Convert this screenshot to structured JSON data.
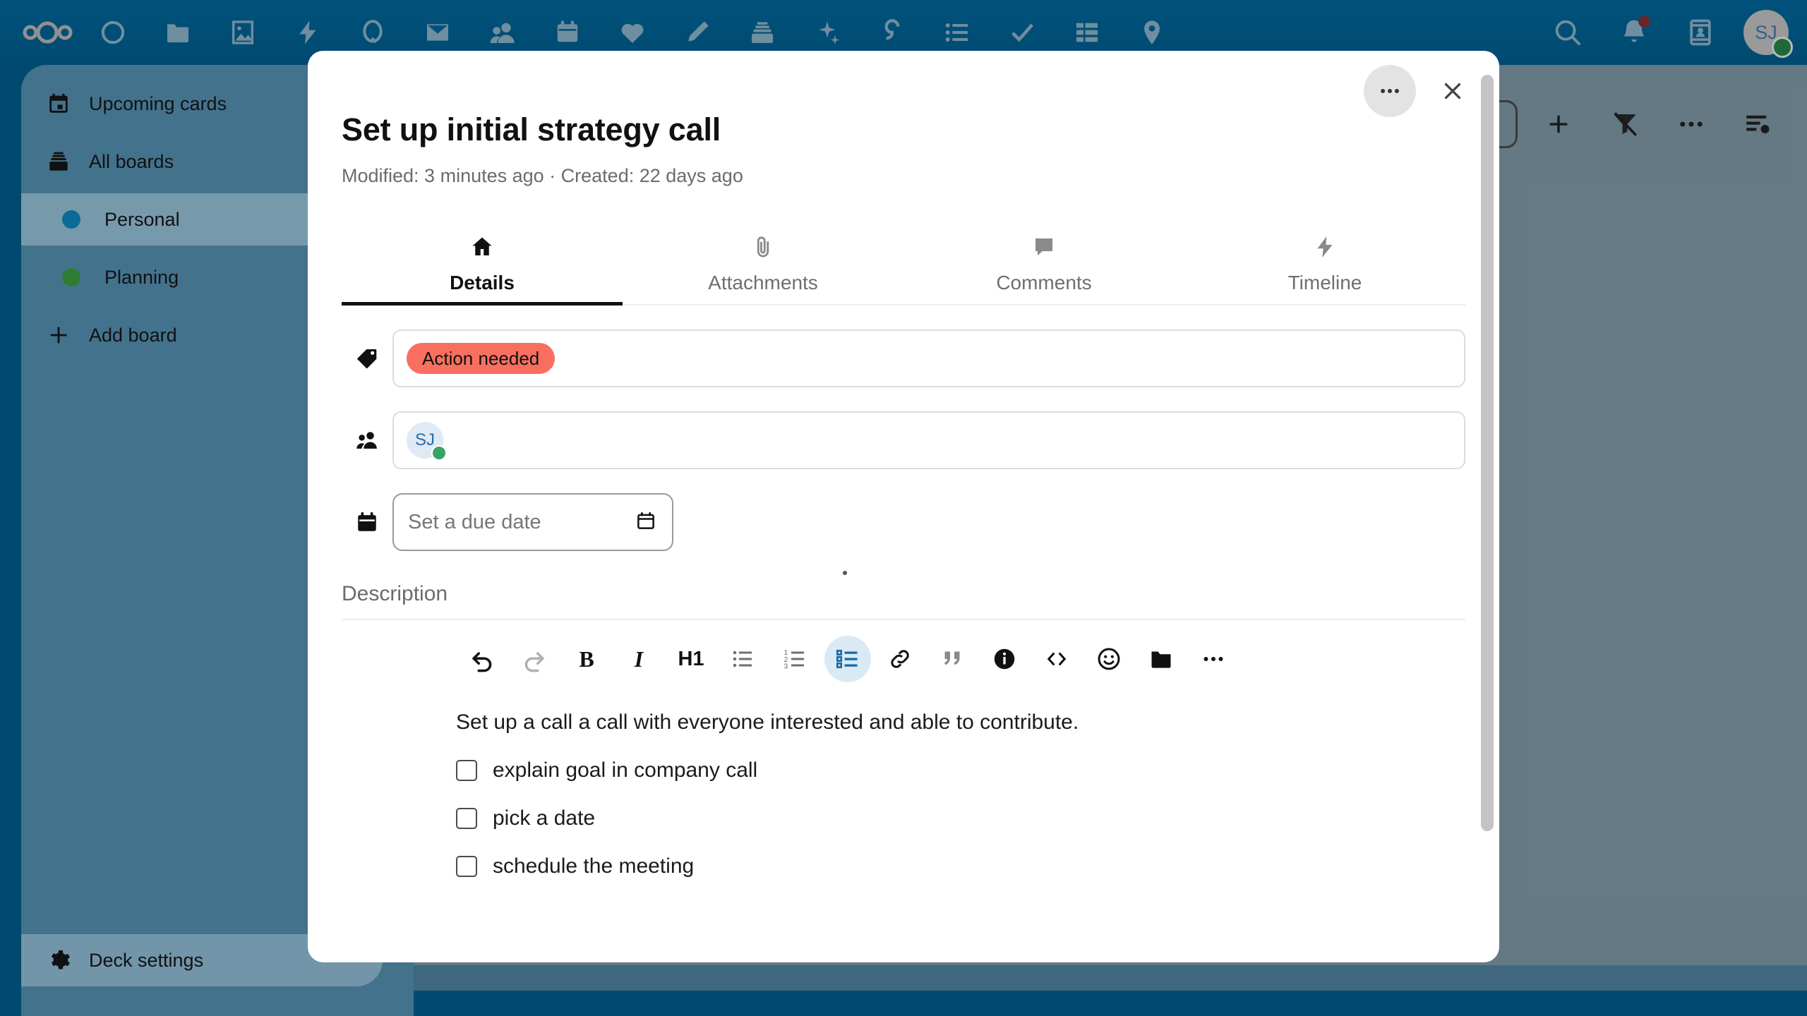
{
  "topnav": {
    "logo_name": "nextcloud-logo",
    "apps": [
      {
        "name": "dashboard-icon",
        "label": "Dashboard"
      },
      {
        "name": "files-icon",
        "label": "Files"
      },
      {
        "name": "photos-icon",
        "label": "Photos"
      },
      {
        "name": "activity-icon",
        "label": "Activity"
      },
      {
        "name": "circles-icon",
        "label": "Circles"
      },
      {
        "name": "mail-icon",
        "label": "Mail"
      },
      {
        "name": "contacts-icon",
        "label": "Contacts"
      },
      {
        "name": "calendar-icon",
        "label": "Calendar"
      },
      {
        "name": "health-icon",
        "label": "Health"
      },
      {
        "name": "notes-icon",
        "label": "Notes"
      },
      {
        "name": "deck-icon",
        "label": "Deck"
      },
      {
        "name": "assistant-icon",
        "label": "Assistant"
      },
      {
        "name": "collectives-icon",
        "label": "Collectives"
      },
      {
        "name": "tasks-list-icon",
        "label": "Tasks"
      },
      {
        "name": "checkmark-icon",
        "label": "Approvals"
      },
      {
        "name": "tables-icon",
        "label": "Tables"
      },
      {
        "name": "maps-icon",
        "label": "Maps"
      }
    ],
    "right": {
      "search_label": "Search",
      "notifications_label": "Notifications",
      "notification_badge": true,
      "contacts_label": "Contacts",
      "avatar_initials": "SJ",
      "status": "online"
    }
  },
  "sidebar": {
    "items": [
      {
        "label": "Upcoming cards",
        "icon": "calendar-icon",
        "type": "nav",
        "active": false
      },
      {
        "label": "All boards",
        "icon": "archive-icon",
        "type": "nav",
        "active": false
      },
      {
        "label": "Personal",
        "icon": "board-dot",
        "color": "#0b6a96",
        "type": "board",
        "active": true
      },
      {
        "label": "Planning",
        "icon": "board-dot",
        "color": "#2f7d32",
        "type": "board",
        "active": false
      },
      {
        "label": "Add board",
        "icon": "plus-icon",
        "type": "action",
        "active": false
      }
    ],
    "footer": {
      "label": "Deck settings",
      "icon": "gear-icon"
    }
  },
  "board_toolbar": {
    "search_placeholder": "",
    "buttons": [
      {
        "name": "add-card-button",
        "icon": "plus-icon"
      },
      {
        "name": "filter-button",
        "icon": "filter-off-icon"
      },
      {
        "name": "board-actions-button",
        "icon": "more-horizontal-icon"
      },
      {
        "name": "details-toggle-button",
        "icon": "details-icon"
      }
    ]
  },
  "modal": {
    "title": "Set up initial strategy call",
    "meta": "Modified: 3 minutes ago · Created: 22 days ago",
    "actions_label": "Card actions",
    "close_label": "Close",
    "tabs": [
      {
        "label": "Details",
        "icon": "home-icon",
        "active": true
      },
      {
        "label": "Attachments",
        "icon": "paperclip-icon",
        "active": false
      },
      {
        "label": "Comments",
        "icon": "comment-icon",
        "active": false
      },
      {
        "label": "Timeline",
        "icon": "activity-icon",
        "active": false
      }
    ],
    "labels_row": {
      "icon": "tag-icon",
      "chips": [
        {
          "text": "Action needed",
          "color": "#f86f5f"
        }
      ]
    },
    "assignees_row": {
      "icon": "people-icon",
      "assignees": [
        {
          "initials": "SJ",
          "status": "online"
        }
      ]
    },
    "due_date_row": {
      "icon": "calendar-icon",
      "placeholder": "Set a due date",
      "value": "",
      "picker_icon": "calendar-picker-icon"
    },
    "description": {
      "label": "Description",
      "toolbar": [
        {
          "name": "undo-icon",
          "glyph": "undo",
          "state": "enabled",
          "active": false
        },
        {
          "name": "redo-icon",
          "glyph": "redo",
          "state": "disabled",
          "active": false
        },
        {
          "name": "bold-icon",
          "glyph": "B",
          "state": "enabled",
          "active": false
        },
        {
          "name": "italic-icon",
          "glyph": "I",
          "state": "enabled",
          "active": false
        },
        {
          "name": "heading-1-icon",
          "glyph": "H1",
          "state": "enabled",
          "active": false
        },
        {
          "name": "bullet-list-icon",
          "glyph": "ul",
          "state": "enabled",
          "active": false
        },
        {
          "name": "ordered-list-icon",
          "glyph": "ol",
          "state": "enabled",
          "active": false
        },
        {
          "name": "task-list-icon",
          "glyph": "checklist",
          "state": "enabled",
          "active": true
        },
        {
          "name": "link-icon",
          "glyph": "link",
          "state": "enabled",
          "active": false
        },
        {
          "name": "blockquote-icon",
          "glyph": "quote",
          "state": "enabled",
          "active": false
        },
        {
          "name": "info-icon",
          "glyph": "info",
          "state": "enabled",
          "active": false
        },
        {
          "name": "code-block-icon",
          "glyph": "code",
          "state": "enabled",
          "active": false
        },
        {
          "name": "emoji-icon",
          "glyph": "emoji",
          "state": "enabled",
          "active": false
        },
        {
          "name": "attachment-folder-icon",
          "glyph": "folder",
          "state": "enabled",
          "active": false
        },
        {
          "name": "more-options-icon",
          "glyph": "more",
          "state": "enabled",
          "active": false
        }
      ],
      "paragraph": "Set up a call a call with everyone interested and able to contribute.",
      "checklist": [
        {
          "text": "explain goal in company call",
          "checked": false
        },
        {
          "text": "pick a date",
          "checked": false
        },
        {
          "text": "schedule the meeting",
          "checked": false
        }
      ]
    }
  },
  "colors": {
    "brand": "#00557f",
    "label_action_needed": "#f86f5f",
    "board_personal": "#0b6a96",
    "board_planning": "#2f7d32",
    "status_online": "#35a464",
    "editor_active_bg": "#daeaf5",
    "editor_active_fg": "#1a6ba8"
  }
}
